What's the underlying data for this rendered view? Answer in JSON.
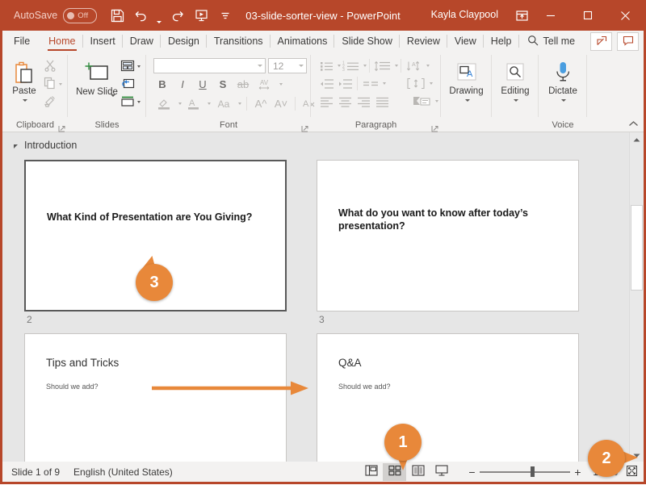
{
  "titlebar": {
    "autosave_label": "AutoSave",
    "autosave_state": "Off",
    "filename": "03-slide-sorter-view",
    "app_name": "PowerPoint",
    "title_separator": "  -  ",
    "user_name": "Kayla Claypool",
    "qat": [
      {
        "name": "save-icon",
        "tooltip": "Save"
      },
      {
        "name": "undo-icon",
        "tooltip": "Undo"
      },
      {
        "name": "redo-icon",
        "tooltip": "Redo"
      },
      {
        "name": "start-from-beginning-icon",
        "tooltip": "Start From Beginning"
      },
      {
        "name": "customize-quick-access-toolbar-icon",
        "tooltip": "Customize Quick Access Toolbar"
      }
    ],
    "window_buttons": [
      "minimize",
      "maximize",
      "close"
    ],
    "ribbon_display_options": "Ribbon Display Options",
    "accent_color": "#b7472a"
  },
  "tabs": [
    {
      "label": "File",
      "active": false
    },
    {
      "label": "Home",
      "active": true
    },
    {
      "label": "Insert",
      "active": false
    },
    {
      "label": "Draw",
      "active": false
    },
    {
      "label": "Design",
      "active": false
    },
    {
      "label": "Transitions",
      "active": false
    },
    {
      "label": "Animations",
      "active": false
    },
    {
      "label": "Slide Show",
      "active": false
    },
    {
      "label": "Review",
      "active": false
    },
    {
      "label": "View",
      "active": false
    },
    {
      "label": "Help",
      "active": false
    }
  ],
  "tellme": {
    "label": "Tell me",
    "icon": "search-icon"
  },
  "tab_right_buttons": [
    {
      "name": "share-button",
      "icon": "share-icon"
    },
    {
      "name": "comments-button",
      "icon": "comment-icon"
    }
  ],
  "ribbon": {
    "groups": [
      {
        "label": "Clipboard",
        "has_dialog_launcher": true,
        "big_button": {
          "label": "Paste",
          "icon": "paste-icon",
          "has_caret": true
        },
        "small_buttons": [
          {
            "name": "cut-button",
            "icon": "scissors-icon",
            "disabled": true
          },
          {
            "name": "copy-button",
            "icon": "copy-icon",
            "has_caret": true,
            "disabled": true
          },
          {
            "name": "format-painter-button",
            "icon": "format-painter-icon",
            "disabled": true
          }
        ]
      },
      {
        "label": "Slides",
        "has_dialog_launcher": false,
        "big_button": {
          "label": "New Slide",
          "icon": "new-slide-icon",
          "has_caret": true
        },
        "small_buttons": [
          {
            "name": "layout-button",
            "icon": "layout-icon",
            "has_caret": true
          },
          {
            "name": "reset-button",
            "icon": "reset-icon"
          },
          {
            "name": "section-button",
            "icon": "section-icon",
            "has_caret": true
          }
        ]
      },
      {
        "label": "Font",
        "has_dialog_launcher": true,
        "font_name_value": "",
        "font_size_value": "12",
        "disabled": true,
        "row1": [
          "bold",
          "italic",
          "underline",
          "shadow",
          "strikethrough",
          "character-spacing"
        ],
        "row2": [
          "text-highlight",
          "font-color",
          "change-case",
          "increase-font-size",
          "decrease-font-size",
          "clear-formatting"
        ]
      },
      {
        "label": "Paragraph",
        "has_dialog_launcher": true,
        "disabled": true,
        "row1": [
          "bullets",
          "numbering",
          "line-spacing",
          "text-direction"
        ],
        "row2": [
          "decrease-indent",
          "increase-indent",
          "columns",
          "align-text"
        ],
        "row3": [
          "align-left",
          "align-center",
          "align-right",
          "justify",
          "convert-to-smartart"
        ]
      },
      {
        "label": "",
        "big_button": {
          "label": "Drawing",
          "icon": "drawing-icon",
          "has_caret": true
        }
      },
      {
        "label": "",
        "big_button": {
          "label": "Editing",
          "icon": "editing-icon",
          "has_caret": true
        }
      },
      {
        "label": "Voice",
        "big_button": {
          "label": "Dictate",
          "icon": "microphone-icon",
          "has_caret": true
        }
      }
    ],
    "collapse_label": "Collapse the Ribbon"
  },
  "workspace": {
    "section": {
      "name": "Introduction",
      "expanded": true
    },
    "slides": [
      {
        "number": "2",
        "title": "What Kind of Presentation are You Giving?",
        "subtitle": "",
        "selected": true,
        "style": "title-bold"
      },
      {
        "number": "3",
        "title": "What do you want to know after today’s presentation?",
        "subtitle": "",
        "selected": false,
        "style": "title-bold"
      },
      {
        "number": "",
        "title": "Tips and Tricks",
        "subtitle": "Should we add?",
        "selected": false,
        "style": "title-plain"
      },
      {
        "number": "",
        "title": "Q&A",
        "subtitle": "Should we add?",
        "selected": false,
        "style": "title-plain"
      }
    ]
  },
  "annotations": {
    "color": "#e8883a",
    "callouts": [
      {
        "number": "1",
        "target": "slide-sorter-view-button"
      },
      {
        "number": "2",
        "target": "zoom-fit-slide-to-window-button"
      },
      {
        "number": "3",
        "target": "slide-drag-arrow"
      }
    ],
    "arrow": {
      "name": "drag-slide-arrow",
      "direction": "right"
    }
  },
  "scrollbar": {
    "up_arrow": "scroll-up-icon",
    "down_arrow": "scroll-down-icon"
  },
  "statusbar": {
    "slide_indicator": "Slide 1 of 9",
    "language": "English (United States)",
    "views": [
      {
        "name": "normal-view-button",
        "label": "Normal",
        "active": false
      },
      {
        "name": "slide-sorter-view-button",
        "label": "Slide Sorter",
        "active": true
      },
      {
        "name": "reading-view-button",
        "label": "Reading View",
        "active": false
      },
      {
        "name": "slide-show-button",
        "label": "Slide Show",
        "active": false
      }
    ],
    "zoom_out_label": "−",
    "zoom_in_label": "+",
    "zoom_value": "100%",
    "fit_button": "fit-slide-to-window-icon"
  }
}
